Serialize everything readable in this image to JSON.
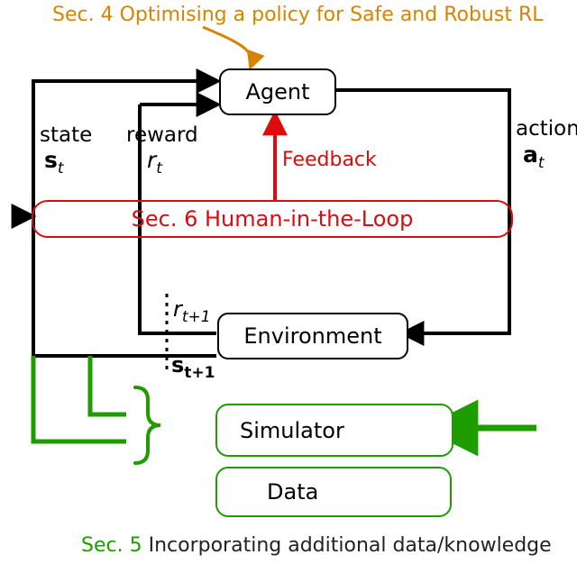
{
  "title": {
    "sec": "Sec. 4",
    "text": "Optimising a policy for Safe and Robust RL"
  },
  "agent": "Agent",
  "environment": "Environment",
  "simulator": "Simulator",
  "data": "Data",
  "hitl": {
    "sec": "Sec. 6",
    "text": "Human-in-the-Loop"
  },
  "state": {
    "word": "state",
    "sym": "s",
    "sub": "t"
  },
  "reward": {
    "word": "reward",
    "sym": "r",
    "sub": "t"
  },
  "feedback": "Feedback",
  "action": {
    "word": "action",
    "sym": "a",
    "sub": "t"
  },
  "rtplus": {
    "sym": "r",
    "sub": "t+1"
  },
  "stplus": {
    "sym": "s",
    "sub": "t+1"
  },
  "bottom": {
    "sec": "Sec. 5",
    "text": "Incorporating additional data/knowledge"
  }
}
